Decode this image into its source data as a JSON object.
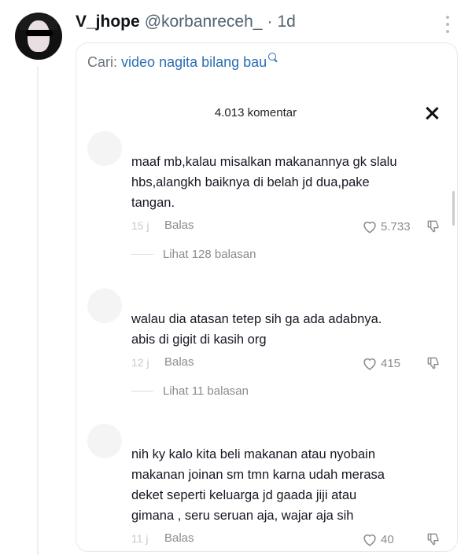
{
  "tweet": {
    "display_name": "V_jhope",
    "handle": "@korbanreceh_",
    "dot": "·",
    "time": "1d"
  },
  "search": {
    "label": "Cari:",
    "query": "video nagita bilang bau"
  },
  "panel": {
    "comment_count": "4.013 komentar"
  },
  "comments": [
    {
      "lines": [
        "maaf mb,kalau misalkan makanannya gk slalu",
        "hbs,alangkh baiknya di belah jd dua,pake",
        "tangan."
      ],
      "age": "15 j",
      "reply_label": "Balas",
      "likes": "5.733",
      "replies_label": "Lihat 128 balasan"
    },
    {
      "lines": [
        "walau dia atasan tetep sih ga ada adabnya.",
        "abis di gigit di kasih org"
      ],
      "age": "12 j",
      "reply_label": "Balas",
      "likes": "415",
      "replies_label": "Lihat 11 balasan"
    },
    {
      "lines": [
        "nih ky kalo kita beli makanan atau nyobain",
        "makanan joinan sm tmn karna udah merasa",
        "deket seperti keluarga jd gaada jiji atau",
        "gimana , seru seruan aja, wajar aja sih"
      ],
      "age": "11 j",
      "reply_label": "Balas",
      "likes": "40"
    }
  ],
  "icons": {
    "more": "more-horizontal-icon",
    "search": "search-icon",
    "close": "close-icon",
    "like": "heart-icon",
    "dislike": "thumbs-down-icon"
  },
  "colors": {
    "link": "#2b6fb3",
    "muted": "#8a8b91"
  }
}
